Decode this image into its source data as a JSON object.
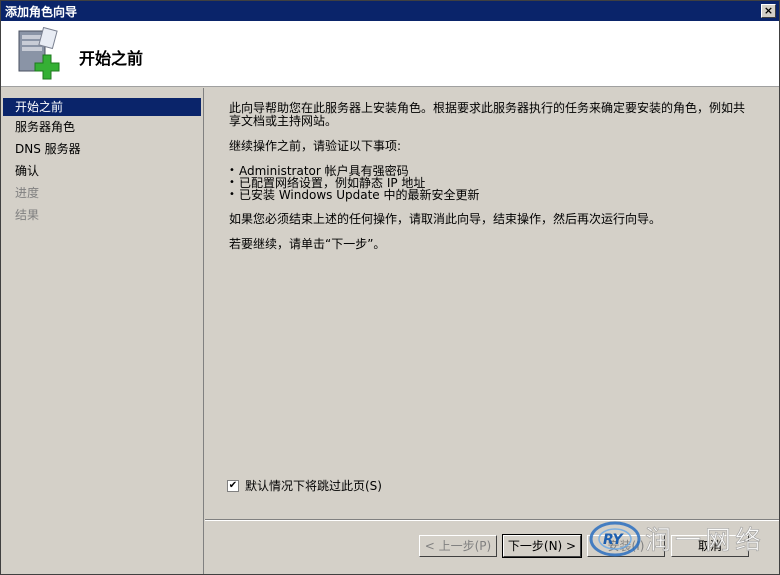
{
  "window": {
    "title": "添加角色向导",
    "close_label": "×"
  },
  "header": {
    "title": "开始之前"
  },
  "sidebar": {
    "items": [
      {
        "label": "开始之前"
      },
      {
        "label": "服务器角色"
      },
      {
        "label": "DNS 服务器"
      },
      {
        "label": "确认"
      },
      {
        "label": "进度"
      },
      {
        "label": "结果"
      }
    ]
  },
  "content": {
    "intro": "此向导帮助您在此服务器上安装角色。根据要求此服务器执行的任务来确定要安装的角色，例如共享文档或主持网站。",
    "verify_heading": "继续操作之前，请验证以下事项:",
    "checklist": [
      "Administrator 帐户具有强密码",
      "已配置网络设置，例如静态 IP 地址",
      "已安装 Windows Update 中的最新安全更新"
    ],
    "cancel_note": "如果您必须结束上述的任何操作，请取消此向导，结束操作，然后再次运行向导。",
    "continue_note": "若要继续，请单击“下一步”。"
  },
  "skip": {
    "checked": true,
    "label": "默认情况下将跳过此页(S)"
  },
  "buttons": {
    "back": "< 上一步(P)",
    "next": "下一步(N) >",
    "install": "安装(I)",
    "cancel": "取消"
  },
  "watermark": {
    "logo_text": "RY",
    "brand_text": "润一网络"
  }
}
